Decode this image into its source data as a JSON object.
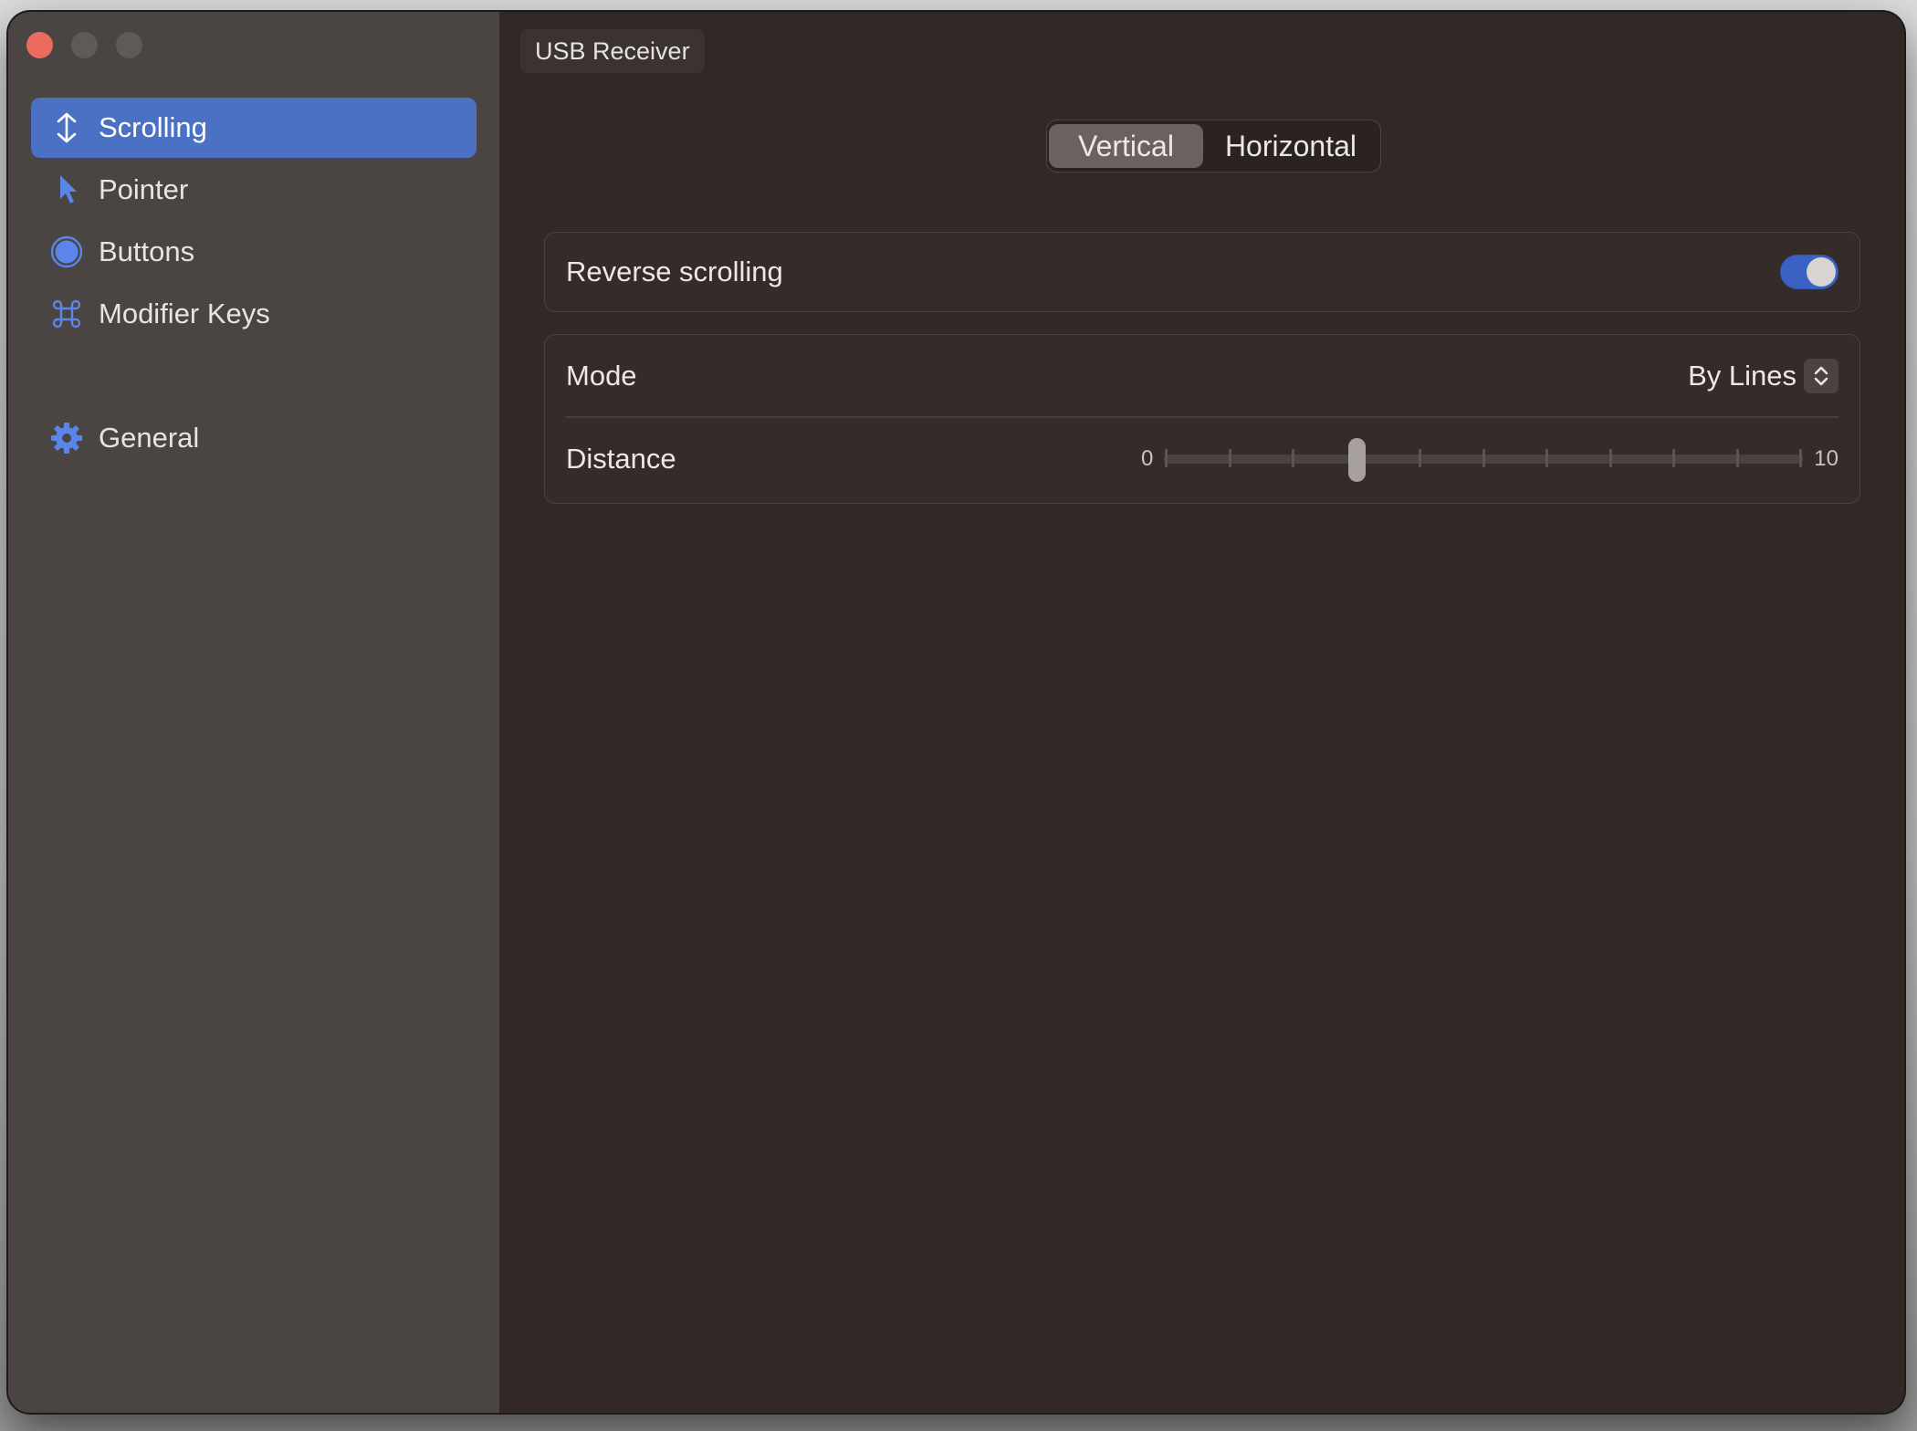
{
  "window": {
    "title": "USB Receiver",
    "traffic_lights": [
      "close",
      "minimize",
      "maximize"
    ]
  },
  "sidebar": {
    "items": [
      {
        "label": "Scrolling",
        "icon": "arrow-up-down-icon",
        "active": true
      },
      {
        "label": "Pointer",
        "icon": "pointer-arrow-icon",
        "active": false
      },
      {
        "label": "Buttons",
        "icon": "circle-button-icon",
        "active": false
      },
      {
        "label": "Modifier Keys",
        "icon": "command-key-icon",
        "active": false
      },
      {
        "label": "General",
        "icon": "gear-icon",
        "active": false
      }
    ]
  },
  "main": {
    "segments": [
      {
        "label": "Vertical",
        "selected": true
      },
      {
        "label": "Horizontal",
        "selected": false
      }
    ],
    "reverse_scrolling": {
      "label": "Reverse scrolling",
      "enabled": true
    },
    "mode": {
      "label": "Mode",
      "value": "By Lines"
    },
    "distance": {
      "label": "Distance",
      "min": 0,
      "max": 10,
      "min_label": "0",
      "max_label": "10",
      "value": 3,
      "ticks": 11
    }
  },
  "colors": {
    "accent": "#4b71c4",
    "toggle_on": "#3a62c4",
    "icon_blue": "#5a86ea",
    "close_red": "#ec6a5e"
  }
}
